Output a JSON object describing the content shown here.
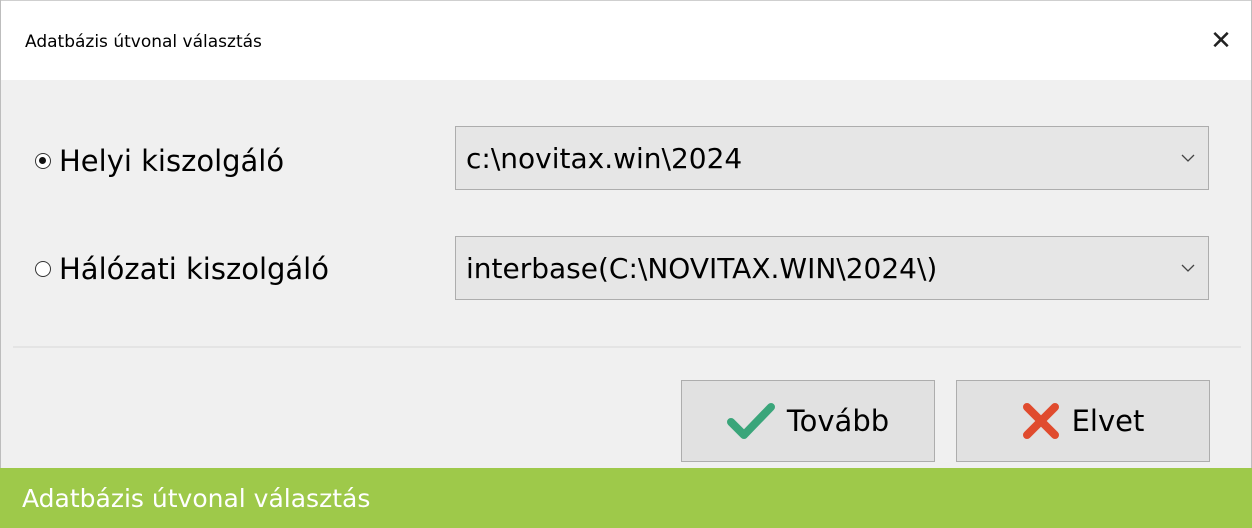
{
  "window": {
    "title": "Adatbázis útvonal választás",
    "close_symbol": "✕"
  },
  "options": {
    "local": {
      "label": "Helyi kiszolgáló",
      "selected": true,
      "path": "c:\\novitax.win\\2024"
    },
    "network": {
      "label": "Hálózati kiszolgáló",
      "selected": false,
      "path": "interbase(C:\\NOVITAX.WIN\\2024\\)"
    }
  },
  "buttons": {
    "ok_label": "Tovább",
    "ok_icon": "checkmark-icon",
    "cancel_label": "Elvet",
    "cancel_icon": "red-x-icon"
  },
  "footer": {
    "caption": "Adatbázis útvonal választás"
  },
  "colors": {
    "banner": "#9ec94a",
    "check": "#3aa57a",
    "cancel_x": "#e04b2e"
  }
}
